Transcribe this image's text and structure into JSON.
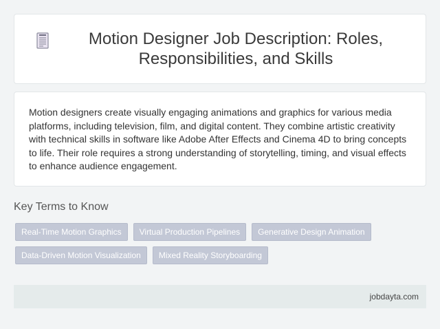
{
  "header": {
    "icon": "document-icon",
    "title": "Motion Designer Job Description: Roles, Responsibilities, and Skills"
  },
  "description": {
    "text": "Motion designers create visually engaging animations and graphics for various media platforms, including television, film, and digital content. They combine artistic creativity with technical skills in software like Adobe After Effects and Cinema 4D to bring concepts to life. Their role requires a strong understanding of storytelling, timing, and visual effects to enhance audience engagement."
  },
  "key_terms": {
    "title": "Key Terms to Know",
    "tags": [
      "Real-Time Motion Graphics",
      "Virtual Production Pipelines",
      "Generative Design Animation",
      "Data-Driven Motion Visualization",
      "Mixed Reality Storyboarding"
    ]
  },
  "footer": {
    "site": "jobdayta.com"
  },
  "colors": {
    "background": "#f2f4f5",
    "tag_bg": "#c3c8d6",
    "footer_bg": "#e5ebeb"
  }
}
